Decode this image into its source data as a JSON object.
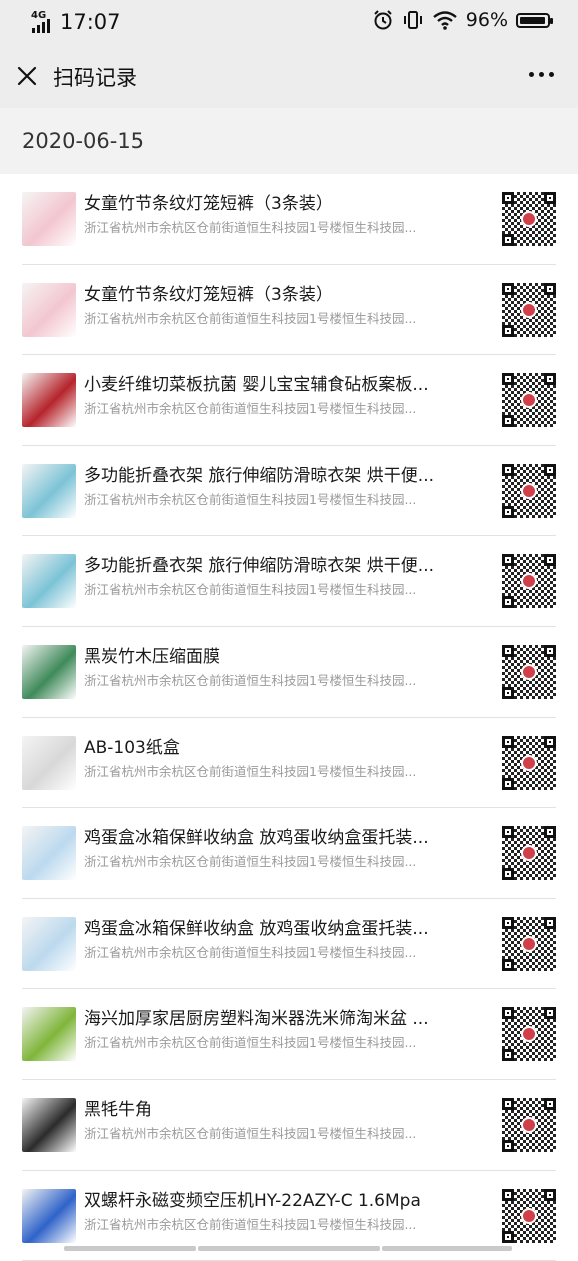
{
  "status_bar": {
    "network": "4G",
    "time": "17:07",
    "battery_percent": "96%",
    "battery_level": 0.96,
    "icons": [
      "alarm-icon",
      "vibrate-icon",
      "wifi-icon",
      "battery-icon"
    ]
  },
  "navbar": {
    "close_icon": "close-icon",
    "title": "扫码记录",
    "more_icon": "more-icon"
  },
  "date_header": "2020-06-15",
  "records": [
    {
      "title": "女童竹节条纹灯笼短裤（3条装）",
      "address": "浙江省杭州市余杭区仓前街道恒生科技园1号楼恒生科技园...",
      "thumb_color": "#f3c6cf"
    },
    {
      "title": "女童竹节条纹灯笼短裤（3条装）",
      "address": "浙江省杭州市余杭区仓前街道恒生科技园1号楼恒生科技园...",
      "thumb_color": "#f3c6cf"
    },
    {
      "title": "小麦纤维切菜板抗菌 婴儿宝宝辅食砧板案板...",
      "address": "浙江省杭州市余杭区仓前街道恒生科技园1号楼恒生科技园...",
      "thumb_color": "#b5242b"
    },
    {
      "title": "多功能折叠衣架 旅行伸缩防滑晾衣架 烘干便...",
      "address": "浙江省杭州市余杭区仓前街道恒生科技园1号楼恒生科技园...",
      "thumb_color": "#7cc3d6"
    },
    {
      "title": "多功能折叠衣架 旅行伸缩防滑晾衣架 烘干便...",
      "address": "浙江省杭州市余杭区仓前街道恒生科技园1号楼恒生科技园...",
      "thumb_color": "#7cc3d6"
    },
    {
      "title": "黑炭竹木压缩面膜",
      "address": "浙江省杭州市余杭区仓前街道恒生科技园1号楼恒生科技园...",
      "thumb_color": "#3f8a5a"
    },
    {
      "title": "AB-103纸盒",
      "address": "浙江省杭州市余杭区仓前街道恒生科技园1号楼恒生科技园...",
      "thumb_color": "#d8d8d8"
    },
    {
      "title": "鸡蛋盒冰箱保鲜收纳盒 放鸡蛋收纳盒蛋托装...",
      "address": "浙江省杭州市余杭区仓前街道恒生科技园1号楼恒生科技园...",
      "thumb_color": "#bcd9ee"
    },
    {
      "title": "鸡蛋盒冰箱保鲜收纳盒 放鸡蛋收纳盒蛋托装...",
      "address": "浙江省杭州市余杭区仓前街道恒生科技园1号楼恒生科技园...",
      "thumb_color": "#bcd9ee"
    },
    {
      "title": "海兴加厚家居厨房塑料淘米器洗米筛淘米盆 ...",
      "address": "浙江省杭州市余杭区仓前街道恒生科技园1号楼恒生科技园...",
      "thumb_color": "#7fb53a"
    },
    {
      "title": "黑牦牛角",
      "address": "浙江省杭州市余杭区仓前街道恒生科技园1号楼恒生科技园...",
      "thumb_color": "#2b2b2b"
    },
    {
      "title": "双螺杆永磁变频空压机HY-22AZY-C 1.6Mpa",
      "address": "浙江省杭州市余杭区仓前街道恒生科技园1号楼恒生科技园...",
      "thumb_color": "#2f63c9"
    }
  ]
}
